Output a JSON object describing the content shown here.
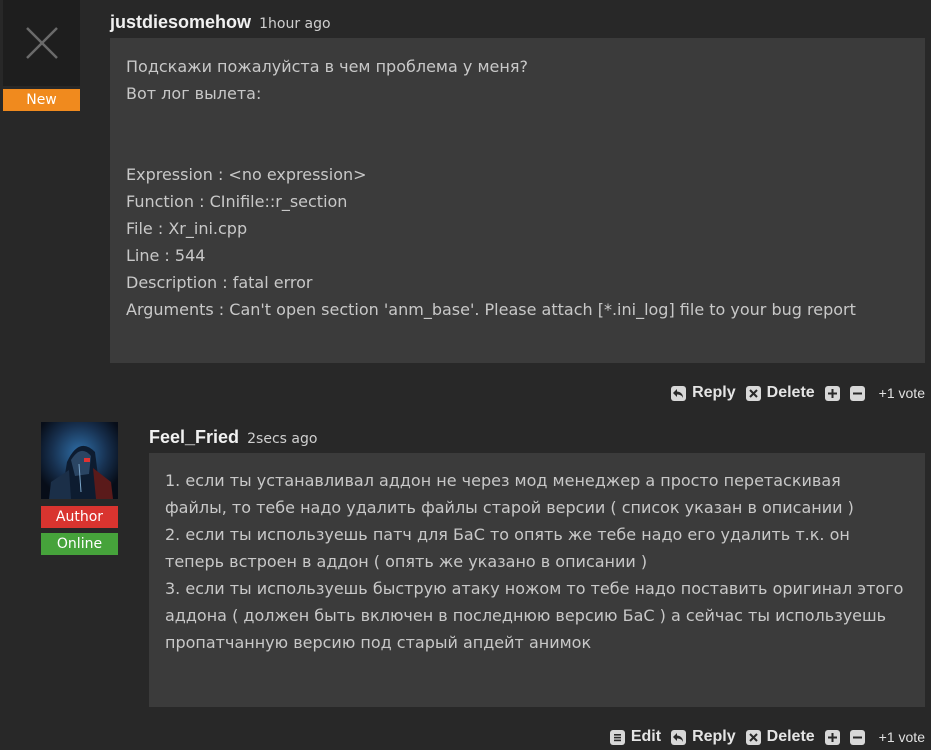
{
  "comment1": {
    "username": "justdiesomehow",
    "time": "1hour ago",
    "badge": "New",
    "lines": [
      "Подскажи пожалуйста в чем проблема у меня?",
      "Вот лог вылета:",
      "",
      "",
      "Expression : <no expression>",
      "Function : CInifile::r_section",
      "File : Xr_ini.cpp",
      "Line : 544",
      "Description : fatal error",
      "Arguments : Can't open section 'anm_base'. Please attach [*.ini_log] file to your bug report"
    ],
    "actions": {
      "reply": "Reply",
      "delete": "Delete"
    },
    "votes": "+1 vote"
  },
  "comment2": {
    "username": "Feel_Fried",
    "time": "2secs ago",
    "badges": {
      "author": "Author",
      "online": "Online"
    },
    "lines": [
      "1. если ты устанавливал аддон не через мод менеджер а просто перетаскивая",
      "файлы, то тебе надо удалить файлы старой версии ( список указан в описании )",
      "2. если ты используешь патч для БаС то опять же тебе надо его удалить т.к. он",
      "теперь встроен в аддон ( опять же указано в описании )",
      "3. если ты используешь быструю атаку ножом то тебе надо поставить оригинал этого",
      "аддона ( должен быть включен в последнюю версию БаС ) а сейчас ты используешь",
      "пропатчанную версию под старый апдейт анимок"
    ],
    "actions": {
      "edit": "Edit",
      "reply": "Reply",
      "delete": "Delete"
    },
    "votes": "+1 vote"
  },
  "icons": {
    "default_avatar": "x-icon",
    "reply": "reply-icon",
    "delete": "delete-icon",
    "edit": "edit-icon",
    "upvote": "plus-icon",
    "downvote": "minus-icon"
  },
  "colors": {
    "background": "#282828",
    "box": "#3b3b3b",
    "new_badge": "#f08a1e",
    "author_badge": "#d9342f",
    "online_badge": "#46a33b"
  }
}
